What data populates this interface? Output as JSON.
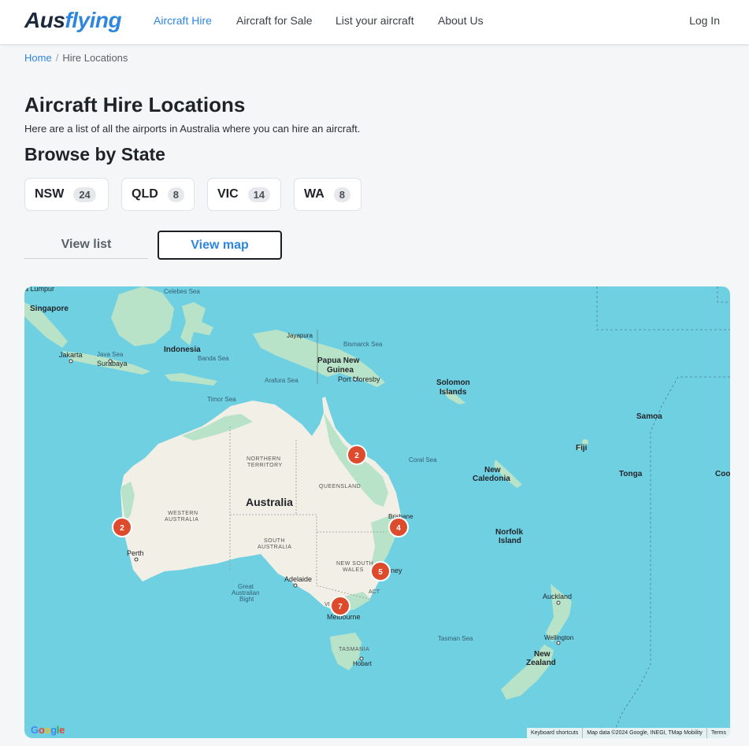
{
  "nav": {
    "logo_part1": "Aus",
    "logo_part2": "flying",
    "links": [
      "Aircraft Hire",
      "Aircraft for Sale",
      "List your aircraft",
      "About Us"
    ],
    "login": "Log In"
  },
  "breadcrumb": {
    "home": "Home",
    "separator": "/",
    "current": "Hire Locations"
  },
  "page": {
    "title": "Aircraft Hire Locations",
    "subtitle": "Here are a list of all the airports in Australia where you can hire an aircraft.",
    "browse_title": "Browse by State"
  },
  "states": [
    {
      "code": "NSW",
      "count": "24"
    },
    {
      "code": "QLD",
      "count": "8"
    },
    {
      "code": "VIC",
      "count": "14"
    },
    {
      "code": "WA",
      "count": "8"
    }
  ],
  "view_tabs": {
    "list": "View list",
    "map": "View map",
    "selected": "map"
  },
  "map": {
    "labels": {
      "kuala_lumpur": "a Lumpur",
      "singapore": "Singapore",
      "celebes_sea": "Celebes Sea",
      "jakarta": "Jakarta",
      "java_sea": "Java Sea",
      "surabaya": "Surabaya",
      "indonesia": "Indonesia",
      "banda_sea": "Banda Sea",
      "jayapura": "Jayapura",
      "bismarck_sea": "Bismarck Sea",
      "png": "Papua New Guinea",
      "png_line1": "Papua New",
      "png_line2": "Guinea",
      "port_moresby": "Port Moresby",
      "arafura_sea": "Arafura Sea",
      "timor_sea": "Timor Sea",
      "solomon_1": "Solomon",
      "solomon_2": "Islands",
      "samoa": "Samoa",
      "fiji": "Fiji",
      "coral_sea": "Coral Sea",
      "new_caledonia_1": "New",
      "new_caledonia_2": "Caledonia",
      "tonga": "Tonga",
      "cook": "Coo",
      "northern_territory_1": "NORTHERN",
      "northern_territory_2": "TERRITORY",
      "queensland": "QUEENSLAND",
      "australia": "Australia",
      "western_australia_1": "WESTERN",
      "western_australia_2": "AUSTRALIA",
      "south_australia_1": "SOUTH",
      "south_australia_2": "AUSTRALIA",
      "brisbane": "Brisbane",
      "norfolk_1": "Norfolk",
      "norfolk_2": "Island",
      "perth": "Perth",
      "nsw_1": "NEW SOUTH",
      "nsw_2": "WALES",
      "sydney": "ney",
      "adelaide": "Adelaide",
      "act": "ACT",
      "gab_1": "Great",
      "gab_2": "Australian",
      "gab_3": "Bight",
      "victoria": "VI",
      "melbourne": "Melbourne",
      "auckland": "Auckland",
      "tasman_sea": "Tasman Sea",
      "wellington": "Wellington",
      "nz_1": "New",
      "nz_2": "Zealand",
      "tasmania": "TASMANIA",
      "hobart": "Hobart"
    },
    "clusters": [
      {
        "name": "queensland-north",
        "count": "2"
      },
      {
        "name": "western-australia",
        "count": "2"
      },
      {
        "name": "brisbane",
        "count": "4"
      },
      {
        "name": "sydney",
        "count": "5"
      },
      {
        "name": "melbourne",
        "count": "7"
      }
    ],
    "footer": {
      "shortcuts": "Keyboard shortcuts",
      "attribution": "Map data ©2024 Google, INEGI, TMap Mobility",
      "terms": "Terms"
    },
    "google": "Google",
    "colors": {
      "water": "#6fd0e2",
      "land": "#f2efe6",
      "vegetation": "#b8e3c8",
      "marker": "#dd4b2c"
    }
  }
}
